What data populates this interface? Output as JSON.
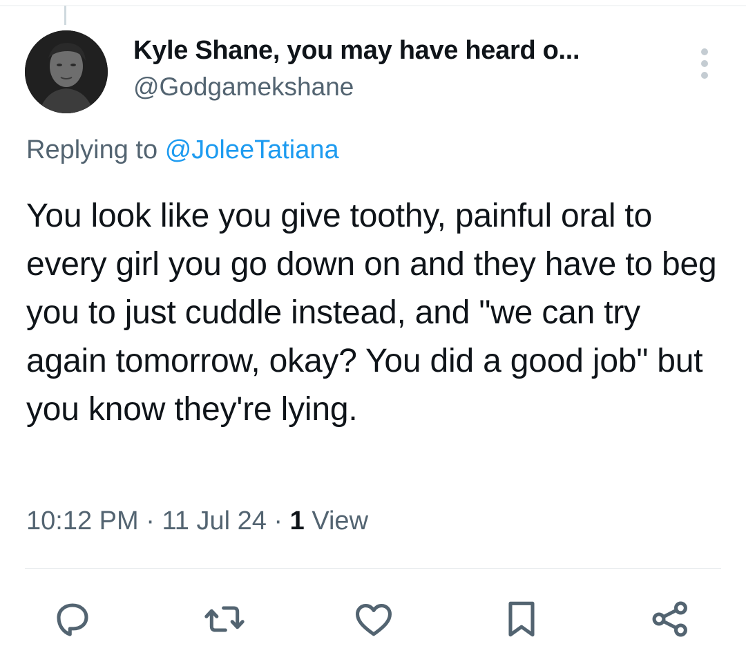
{
  "tweet": {
    "author": {
      "display_name": "Kyle Shane, you may have heard o...",
      "handle": "@Godgamekshane"
    },
    "replying_to": {
      "prefix": "Replying to",
      "mention": "@JoleeTatiana"
    },
    "text": "You look like you give toothy, painful oral to every girl you go down on and they have to beg you to just cuddle instead, and \"we can try again tomorrow, okay? You did a good job\" but you know they're lying.",
    "time": "10:12 PM",
    "date": "11 Jul 24",
    "views_count": "1",
    "views_label": "View"
  },
  "actions": {
    "reply_icon": "reply-icon",
    "retweet_icon": "retweet-icon",
    "like_icon": "like-icon",
    "bookmark_icon": "bookmark-icon",
    "share_icon": "share-icon"
  },
  "colors": {
    "text": "#0f1419",
    "secondary": "#536471",
    "link": "#1d9bf0",
    "icon": "#536471",
    "divider": "#e6e9ec"
  }
}
